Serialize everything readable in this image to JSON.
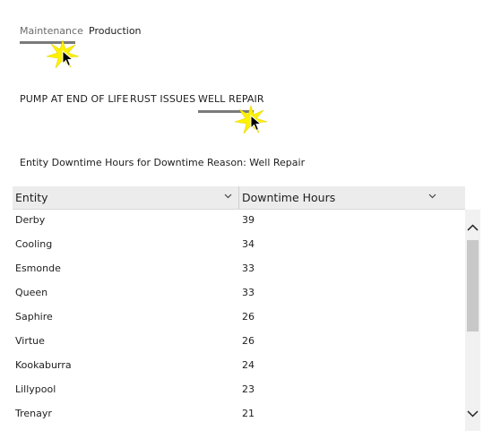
{
  "top_tabs": [
    {
      "label": "Maintenance",
      "state": "inactive"
    },
    {
      "label": "Production",
      "state": "active"
    }
  ],
  "sub_tabs": [
    {
      "label": "PUMP AT END OF LIFE"
    },
    {
      "label": "RUST ISSUES"
    },
    {
      "label": "WELL REPAIR",
      "state": "selected"
    }
  ],
  "caption": "Entity Downtime Hours for Downtime Reason: Well Repair",
  "table": {
    "columns": [
      "Entity",
      "Downtime Hours"
    ],
    "rows": [
      {
        "entity": "Derby",
        "hours": "39"
      },
      {
        "entity": "Cooling",
        "hours": "34"
      },
      {
        "entity": "Esmonde",
        "hours": "33"
      },
      {
        "entity": "Queen",
        "hours": "33"
      },
      {
        "entity": "Saphire",
        "hours": "26"
      },
      {
        "entity": "Virtue",
        "hours": "26"
      },
      {
        "entity": "Kookaburra",
        "hours": "24"
      },
      {
        "entity": "Lillypool",
        "hours": "23"
      },
      {
        "entity": "Trenayr",
        "hours": "21"
      }
    ]
  },
  "icons": {
    "sort": "chevron-down-icon",
    "scroll_up": "chevron-up-icon",
    "scroll_down": "chevron-down-icon",
    "cursor": "mouse-pointer-icon",
    "click_highlight": "click-burst-icon"
  },
  "colors": {
    "underline": "#7a7a7a",
    "header_bg": "#ececec",
    "click_burst": "#fff200",
    "scroll_thumb": "#c8c8c8"
  }
}
